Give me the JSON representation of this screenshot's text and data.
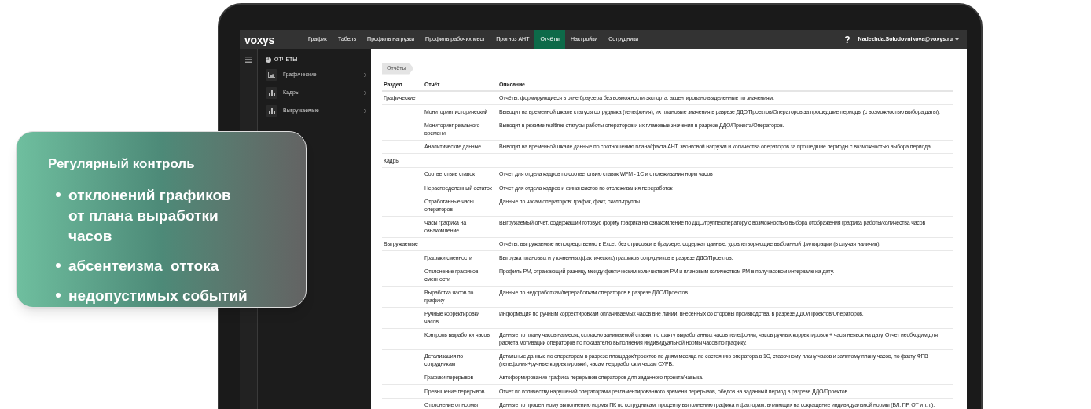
{
  "navbar": {
    "logo": "voxys",
    "items": [
      {
        "label": "График",
        "selected": false
      },
      {
        "label": "Табель",
        "selected": false
      },
      {
        "label": "Профиль нагрузки",
        "selected": false
      },
      {
        "label": "Профиль рабочих мест",
        "selected": false
      },
      {
        "label": "Прогноз АНТ",
        "selected": false
      },
      {
        "label": "Отчёты",
        "selected": true
      },
      {
        "label": "Настройки",
        "selected": false
      },
      {
        "label": "Сотрудники",
        "selected": false
      }
    ],
    "help": "?",
    "user": "Nadezhda.Solodovnikova@voxys.ru"
  },
  "sidebar": {
    "title": "ОТЧЕТЫ",
    "items": [
      {
        "label": "Графические",
        "kind": "area"
      },
      {
        "label": "Кадры",
        "kind": "bars"
      },
      {
        "label": "Выгружаемые",
        "kind": "bars"
      }
    ]
  },
  "breadcrumb": "Отчёты",
  "table": {
    "columns": [
      "Раздел",
      "Отчёт",
      "Описание"
    ],
    "rows": [
      {
        "section": "Графические",
        "description": "Отчёты, формирующиеся в окне браузера без возможности экспорта; акцентировано выделенные по значениям."
      },
      {
        "report": "Мониторинг исторический",
        "description": "Выводит на временной шкале статусы сотрудника (телефония), их плановые значения в разрезе ДДО/Проектов/Операторов за прошедшие периоды (с возможностью выбора даты)."
      },
      {
        "report": "Мониторинг реального времени",
        "description": "Выводит в режиме realtime статусы работы операторов и их плановые значения в разрезе ДДО/Проекта/Операторов."
      },
      {
        "report": "Аналитические данные",
        "description": "Выводит на временной шкале данные по соотношению плана/факта АНТ, звонковой нагрузки и количества операторов за прошедшие периоды с возможностью выбора периода."
      },
      {
        "section": "Кадры"
      },
      {
        "report": "Соответствие ставок",
        "description": "Отчет для отдела кадров по соответствию ставок WFM - 1С и отслеживания норм часов"
      },
      {
        "report": "Нераспределенный остаток",
        "description": "Отчет для отдела кадров и финансистов по отслеживания переработок"
      },
      {
        "report": "Отработанные часы операторов",
        "description": "Данные по часам операторов: график, факт, скилл-группы"
      },
      {
        "report": "Часы графика на ознакомление",
        "description": "Выгружаемый отчёт, содержащий готовую форму графика на ознакомление по ДДО/группе/оператору с возможностью выбора отображения графика работы/количества часов"
      },
      {
        "section": "Выгружаемые",
        "description": "Отчёты, выгружаемые непосредственно в Excel, без отрисовки в браузере; содержат данные, удовлетворяющие выбранной фильтрации (в случая наличия)."
      },
      {
        "report": "Графики сменности",
        "description": "Выгрузка плановых и уточненных(фактических) графиков сотрудников в разрезе ДДО/Проектов."
      },
      {
        "report": "Отклонение графиков сменности",
        "description": "Профиль РМ, отражающий разницу между фактическим количеством РМ и плановым количеством РМ в получасовом интервале на дату."
      },
      {
        "report": "Выработка часов по графику",
        "description": "Данные по недоработкам/переработкам операторов в разрезе ДДО/Проектов."
      },
      {
        "report": "Ручные корректировки часов",
        "description": "Информация по ручным корректировкам оплачиваемых часов вне линии, внесенных со стороны производства, в разрезе ДДО/Проектов/Операторов."
      },
      {
        "report": "Контроль выработки часов",
        "description": "Данные по плану часов на месяц согласно занимаемой ставки, по факту выработанных часов телефонии, часов ручных корректировок + часы неявок на дату. Отчет необходим для расчета мотивации операторов по показателю выполнения индивидуальной нормы часов по графику."
      },
      {
        "report": "Детализация по сотрудникам",
        "description": "Детальные данные по операторам в разрезе площадок/проектов по дням месяца по состоянию оператора в 1С, ставочному плану часов и залитому плану часов, по факту ФРВ (телефония+ручные корректировки), часам недоработок и часам СУРВ."
      },
      {
        "report": "Графики перерывов",
        "description": "Автоформирование графика перерывов операторов для заданного проекта/навыка."
      },
      {
        "report": "Превышение перерывов",
        "description": "Отчет по количеству нарушений операторами регламентированного времени перерывов, обедов на заданный период в разрезе ДДО/Проектов."
      },
      {
        "report": "Отклонение от нормы",
        "description": "Данные по процентному выполнению нормы ПК по сотрудникам, проценту выполнению графика и факторам, влияющих на сокращение индивидуальной нормы (БЛ, ПР, ОТ и т.п.)."
      }
    ]
  },
  "promo": {
    "title": "Регулярный контроль",
    "bullets": [
      "отклонений графиков от плана выработки часов",
      "абсентеизма  оттока",
      "недопустимых событий"
    ]
  }
}
